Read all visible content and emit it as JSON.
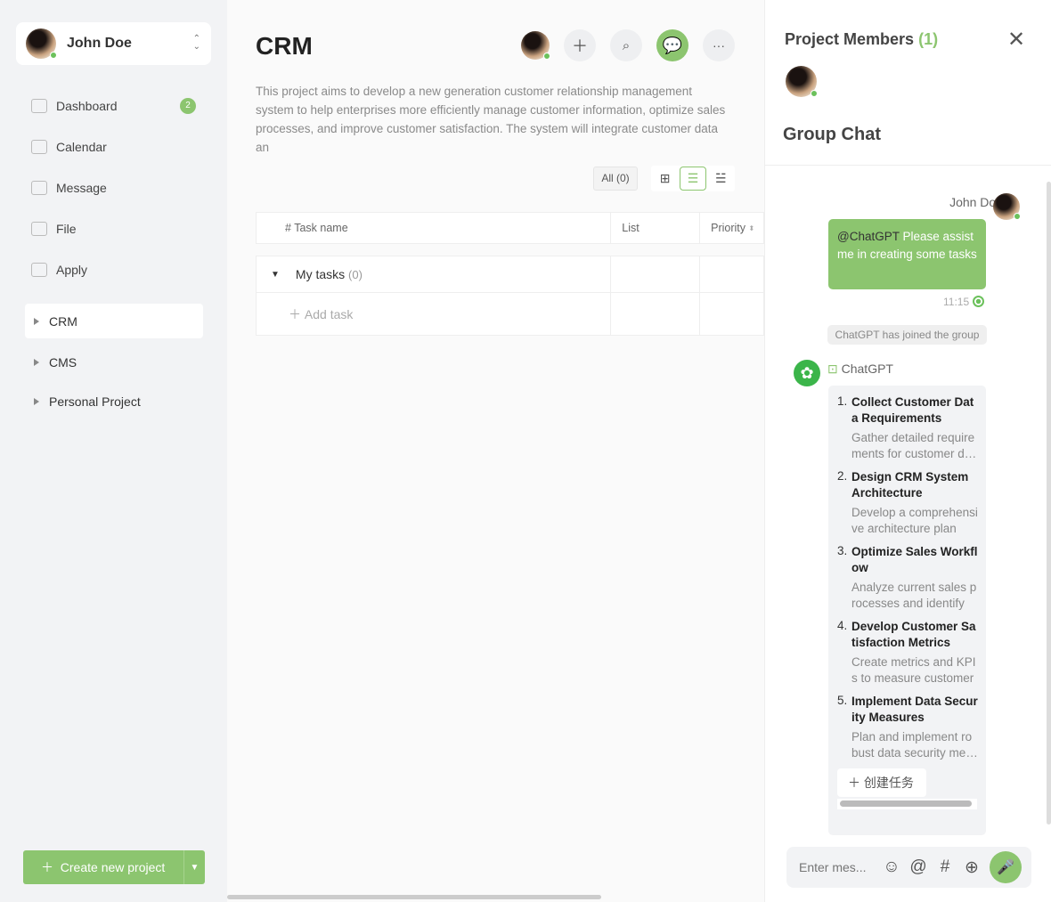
{
  "user": {
    "name": "John Doe"
  },
  "nav": [
    {
      "label": "Dashboard",
      "badge": "2"
    },
    {
      "label": "Calendar"
    },
    {
      "label": "Message"
    },
    {
      "label": "File"
    },
    {
      "label": "Apply"
    }
  ],
  "projects": [
    "CRM",
    "CMS",
    "Personal Project"
  ],
  "create_label": "Create new project",
  "main": {
    "title": "CRM",
    "description": "This project aims to develop a new generation customer relationship management system to help enterprises more efficiently manage customer information, optimize sales processes, and improve customer satisfaction. The system will integrate customer data an",
    "filter": "All (0)",
    "columns": [
      "# Task name",
      "List",
      "Priority"
    ],
    "group": "My tasks",
    "group_count": "(0)",
    "add_task": "Add task"
  },
  "panel": {
    "members_title": "Project Members",
    "members_count": "(1)",
    "chat_title": "Group Chat",
    "msg_sender": "John Doe",
    "msg_mention": "@ChatGPT",
    "msg_text": " Please assist me in creating some tasks",
    "msg_time": "11:15",
    "system": "ChatGPT has joined the group",
    "bot_name": "ChatGPT",
    "tasks": [
      {
        "n": "1.",
        "title": "Collect Customer Data Requirements",
        "desc": "Gather detailed requirements for customer data"
      },
      {
        "n": "2.",
        "title": "Design CRM System Architecture",
        "desc": "Develop a comprehensive architecture plan"
      },
      {
        "n": "3.",
        "title": "Optimize Sales Workflow",
        "desc": "Analyze current sales processes and identify"
      },
      {
        "n": "4.",
        "title": "Develop Customer Satisfaction Metrics",
        "desc": "Create metrics and KPIs to measure customer"
      },
      {
        "n": "5.",
        "title": "Implement Data Security Measures",
        "desc": "Plan and implement robust data security measures"
      }
    ],
    "create_task": "创建任务",
    "input_placeholder": "Enter mes..."
  },
  "colors": {
    "accent": "#8cc56f",
    "online": "#6cc15c"
  }
}
